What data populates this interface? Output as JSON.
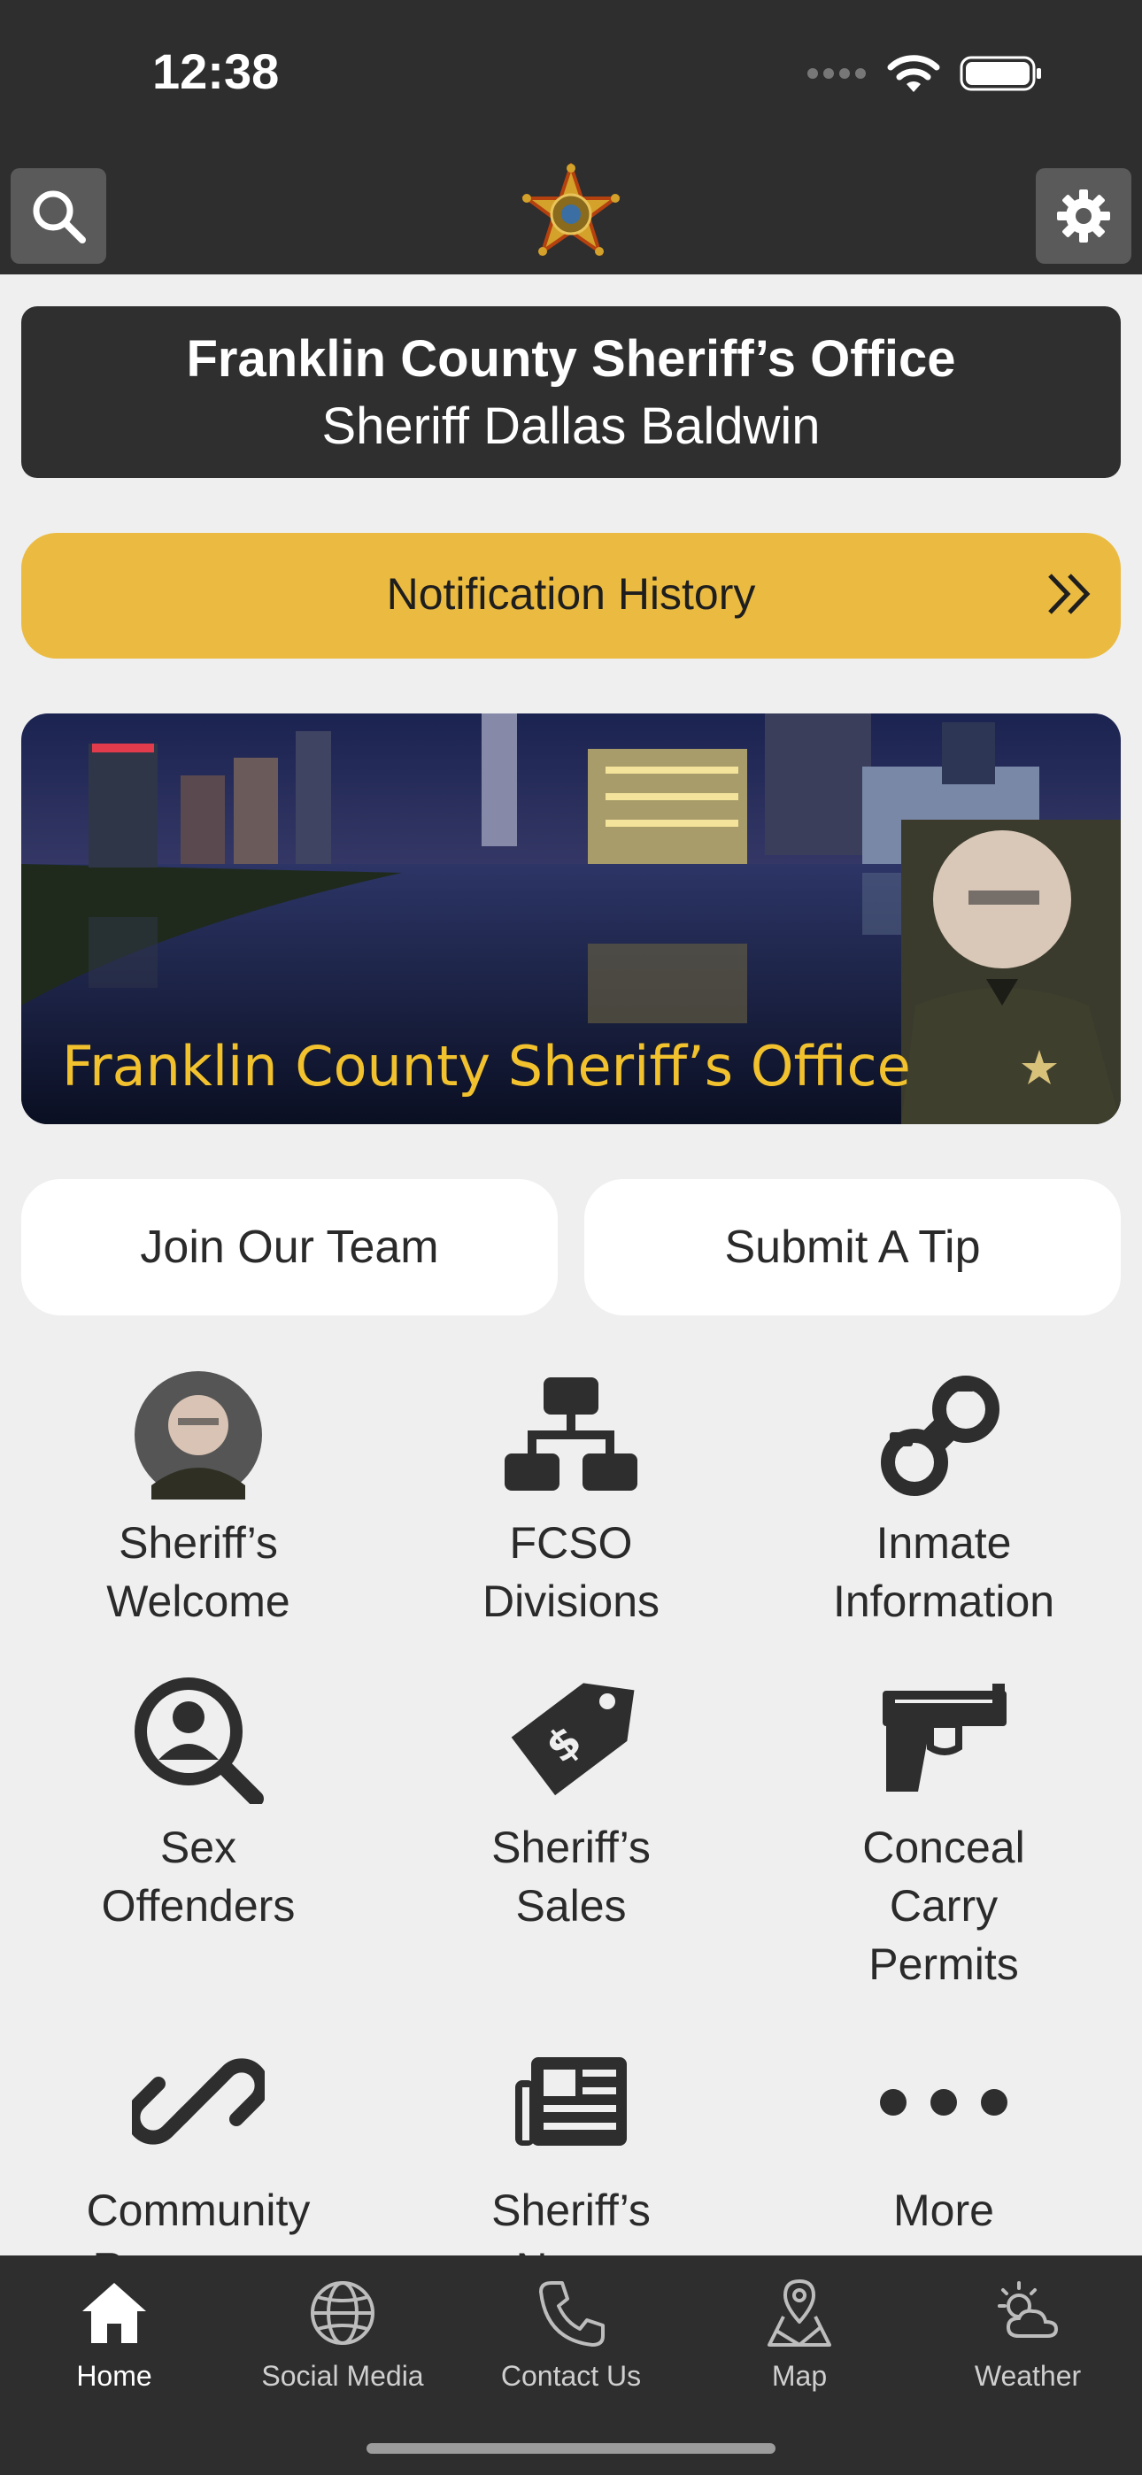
{
  "status_bar": {
    "time": "12:38"
  },
  "header": {
    "search_icon": "search-icon",
    "settings_icon": "gear-icon",
    "logo": "sheriff-star-badge"
  },
  "title_card": {
    "line1": "Franklin County Sheriff’s Office",
    "line2": "Sheriff Dallas Baldwin"
  },
  "notification": {
    "label": "Notification History",
    "icon": "double-chevron-right-icon"
  },
  "banner": {
    "caption": "Franklin County Sheriff’s Office"
  },
  "actions": {
    "join": "Join Our Team",
    "tip": "Submit A Tip"
  },
  "grid": {
    "items": [
      {
        "line1": "Sheriff’s",
        "line2": "Welcome",
        "line3": "",
        "icon": "sheriff-photo"
      },
      {
        "line1": "FCSO",
        "line2": "Divisions",
        "line3": "",
        "icon": "org-chart-icon"
      },
      {
        "line1": "Inmate",
        "line2": "Information",
        "line3": "",
        "icon": "handcuffs-icon"
      },
      {
        "line1": "Sex",
        "line2": "Offenders",
        "line3": "",
        "icon": "person-search-icon"
      },
      {
        "line1": "Sheriff’s",
        "line2": "Sales",
        "line3": "",
        "icon": "price-tag-icon"
      },
      {
        "line1": "Conceal",
        "line2": "Carry",
        "line3": "Permits",
        "icon": "pistol-icon"
      },
      {
        "line1": "Community",
        "line2": "Resources",
        "line3": "",
        "icon": "link-icon"
      },
      {
        "line1": "Sheriff’s",
        "line2": "News",
        "line3": "",
        "icon": "newspaper-icon"
      },
      {
        "line1": "More",
        "line2": "",
        "line3": "",
        "icon": "more-icon"
      }
    ]
  },
  "tabbar": {
    "tabs": [
      {
        "label": "Home",
        "icon": "home-icon",
        "active": true
      },
      {
        "label": "Social Media",
        "icon": "globe-icon"
      },
      {
        "label": "Contact Us",
        "icon": "phone-icon"
      },
      {
        "label": "Map",
        "icon": "map-pin-icon"
      },
      {
        "label": "Weather",
        "icon": "weather-icon"
      }
    ]
  },
  "colors": {
    "header": "#2e2e2e",
    "accent": "#ebbb41",
    "background": "#efefef",
    "banner_text": "#f2c12e"
  }
}
